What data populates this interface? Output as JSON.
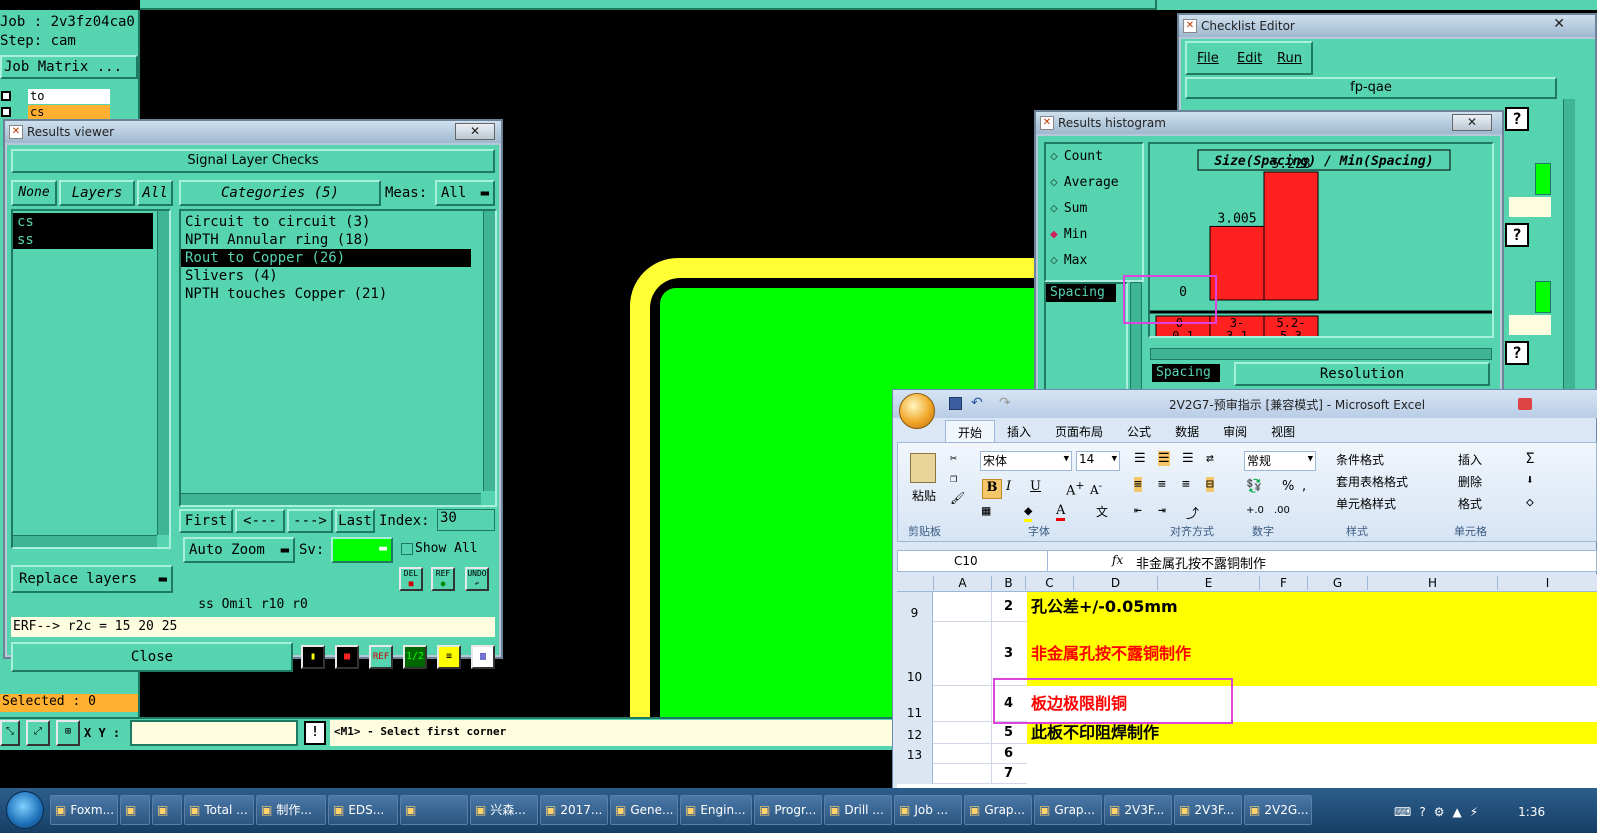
{
  "main": {
    "job_label": "Job : 2v3fz04ca0",
    "step_label": "Step: cam",
    "job_matrix": "Job Matrix ...",
    "layers": [
      "to",
      "cs"
    ],
    "selected_status": "Selected : 0",
    "xy_label": "X Y :",
    "xy_value": "",
    "warn_icon": "!",
    "prompt": "<M1> - Select first corner"
  },
  "results_viewer": {
    "title": "Results viewer",
    "header": "Signal Layer Checks",
    "none_btn": "None",
    "layers_btn": "Layers",
    "all_btn": "All",
    "categories_btn": "Categories (5)",
    "meas_label": "Meas:",
    "meas_value": "All",
    "layer_items": [
      "cs",
      "ss"
    ],
    "categories": [
      "Circuit to circuit (3)",
      "NPTH Annular ring (18)",
      "Rout to Copper (26)",
      "Slivers (4)",
      "NPTH touches Copper (21)"
    ],
    "selected_category_index": 2,
    "first_btn": "First",
    "prev_btn": "<---",
    "next_btn": "--->",
    "last_btn": "Last",
    "index_label": "Index:",
    "index_value": "30",
    "auto_zoom": "Auto Zoom",
    "sv_label": "Sv:",
    "show_all": "Show All",
    "replace_layers": "Replace layers",
    "del_label": "DEL",
    "ref_label": "REF",
    "undo_label": "UNDO",
    "status_line": "ss Omil   r10   r0",
    "erf_line": "ERF--> r2c = 15 20 25",
    "close_btn": "Close"
  },
  "checklist_editor": {
    "title": "Checklist Editor",
    "menu": [
      "File",
      "Edit",
      "Run"
    ],
    "name": "fp-qae",
    "help": "?"
  },
  "results_histogram": {
    "title": "Results histogram",
    "options": [
      "Count",
      "Average",
      "Sum",
      "Min",
      "Max"
    ],
    "selected_option": "Min",
    "list_item": "Spacing",
    "chart_title": "Size(Spacing) / Min(Spacing)",
    "spacing_label": "Spacing",
    "resolution_label": "Resolution"
  },
  "chart_data": {
    "type": "bar",
    "title": "Size(Spacing) / Min(Spacing)",
    "categories": [
      "0-0.1",
      "3-3.1",
      "5.2-5.3"
    ],
    "category_labels": [
      [
        "0-",
        "0.1"
      ],
      [
        "3-",
        "3.1"
      ],
      [
        "5.2-",
        "5.3"
      ]
    ],
    "values": [
      0,
      3.005,
      5.228
    ],
    "value_labels": [
      "0",
      "3.005",
      "5.228"
    ],
    "ylim": [
      0,
      5.228
    ],
    "bar_color": "#ff2020",
    "grid": false,
    "legend": "none"
  },
  "excel": {
    "title": "2V2G7-预审指示 [兼容模式] - Microsoft Excel",
    "tabs": [
      "开始",
      "插入",
      "页面布局",
      "公式",
      "数据",
      "审阅",
      "视图"
    ],
    "font_name": "宋体",
    "font_size": "14",
    "number_format": "常规",
    "paste_label": "粘贴",
    "groups": [
      "剪贴板",
      "字体",
      "对齐方式",
      "数字",
      "样式",
      "单元格"
    ],
    "style_items": [
      "条件格式",
      "套用表格格式",
      "单元格样式"
    ],
    "cell_items": [
      "插入",
      "删除",
      "格式"
    ],
    "name_box": "C10",
    "fx_label": "fx",
    "formula": "非金属孔按不露铜制作",
    "columns": [
      "A",
      "B",
      "C",
      "D",
      "E",
      "F",
      "G",
      "H",
      "I"
    ],
    "rows": [
      {
        "num": "9",
        "b": "2",
        "text": "孔公差+/-0.05mm",
        "fill": "#ffff00",
        "color": "#000000"
      },
      {
        "num": "10",
        "b": "3",
        "text": "非金属孔按不露铜制作",
        "fill": "#ffff00",
        "color": "#ff0000"
      },
      {
        "num": "11",
        "b": "4",
        "text": "板边极限削铜",
        "fill": "#ffffff",
        "color": "#ff0000"
      },
      {
        "num": "12",
        "b": "5",
        "text": "此板不印阻焊制作",
        "fill": "#ffff00",
        "color": "#000000"
      },
      {
        "num": "13",
        "b": "6",
        "text": "",
        "fill": "#ffffff",
        "color": "#000000"
      },
      {
        "num": "",
        "b": "7",
        "text": "",
        "fill": "#ffffff",
        "color": "#000000"
      }
    ]
  },
  "taskbar": {
    "items": [
      "Foxm...",
      "",
      "",
      "Total ...",
      "制作...",
      "EDS...",
      "",
      "兴森...",
      "2017...",
      "Gene...",
      "Engin...",
      "Progr...",
      "Drill ...",
      "Job ...",
      "Grap...",
      "Grap...",
      "2V3F...",
      "2V3F...",
      "2V2G..."
    ],
    "clock": "1:36"
  },
  "colors": {
    "motif": "#56d4b0",
    "board_green": "#00ff00",
    "board_yellow": "#ffff33",
    "highlight": "#dd44dd"
  }
}
